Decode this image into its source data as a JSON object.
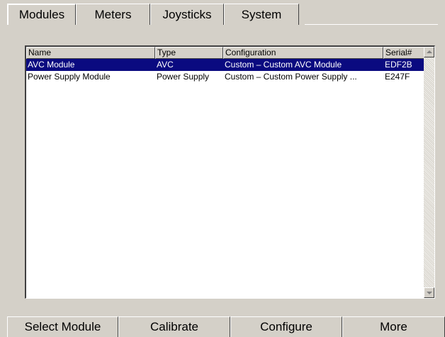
{
  "tabs": [
    {
      "label": "Modules",
      "active": true
    },
    {
      "label": "Meters"
    },
    {
      "label": "Joysticks"
    },
    {
      "label": "System"
    }
  ],
  "list": {
    "columns": [
      "Name",
      "Type",
      "Configuration",
      "Serial#"
    ],
    "rows": [
      {
        "name": "AVC Module",
        "type": "AVC",
        "configuration": "Custom – Custom AVC Module",
        "serial": "EDF2B",
        "selected": true
      },
      {
        "name": "Power Supply Module",
        "type": "Power Supply",
        "configuration": "Custom – Custom Power Supply ...",
        "serial": "E247F"
      }
    ]
  },
  "actions": [
    "Select Module",
    "Calibrate",
    "Configure",
    "More"
  ],
  "colors": {
    "selection": "#0a0a80",
    "face": "#d4d0c8"
  }
}
